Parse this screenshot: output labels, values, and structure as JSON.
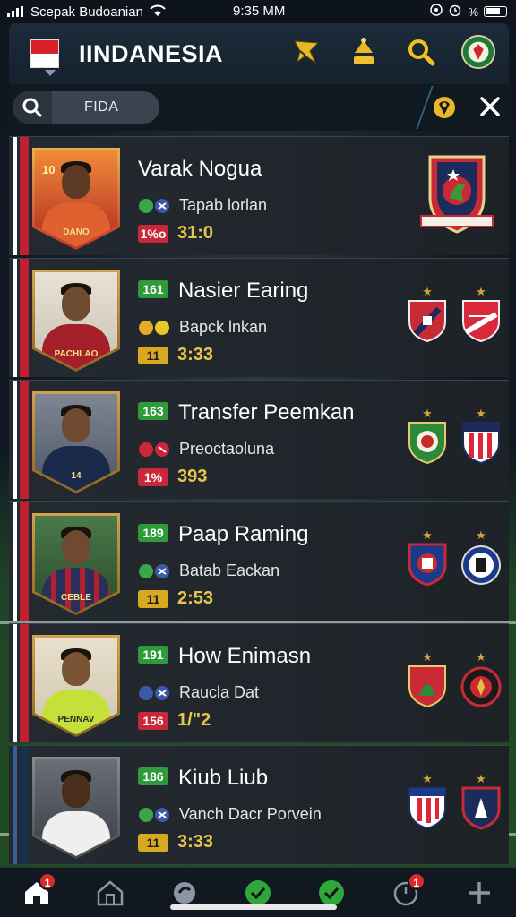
{
  "status_bar": {
    "carrier": "Scepak Budoanian",
    "time": "9:35 MM"
  },
  "header": {
    "title": "IINDANESIA",
    "flag_colors": [
      "#d8202a",
      "#ffffff"
    ]
  },
  "search": {
    "value": "FIDA"
  },
  "players": [
    {
      "name": "Varak Nogua",
      "ovr": "",
      "sub_text": "Tapab lorlan",
      "stat_tag": "1%o",
      "stat_tag_color": "#c8283a",
      "stat_value": "31:0",
      "rating_badge": "10",
      "shirt_text": "DANO",
      "shirt_color": "#d85a2a",
      "stripe": "red",
      "clubs": 1
    },
    {
      "name": "Nasier Earing",
      "ovr": "161",
      "sub_text": "Bapck lnkan",
      "stat_tag": "11",
      "stat_tag_color": "#d8a820",
      "stat_value": "3:33",
      "rating_badge": "",
      "shirt_text": "PACHLAO",
      "shirt_color": "#a51f28",
      "stripe": "red",
      "clubs": 2
    },
    {
      "name": "Transfer Peemkan",
      "ovr": "163",
      "sub_text": "Preoctaoluna",
      "stat_tag": "1%",
      "stat_tag_color": "#c8283a",
      "stat_value": "393",
      "rating_badge": "",
      "shirt_text": "14",
      "shirt_color": "#1a2a4a",
      "stripe": "red",
      "clubs": 2
    },
    {
      "name": "Paap Raming",
      "ovr": "189",
      "sub_text": "Batab Eackan",
      "stat_tag": "11",
      "stat_tag_color": "#d8a820",
      "stat_value": "2:53",
      "rating_badge": "",
      "shirt_text": "CEBLE",
      "shirt_color": "#2a2f5a",
      "stripe": "red",
      "clubs": 2
    },
    {
      "name": "How Enimasn",
      "ovr": "191",
      "sub_text": "Raucla Dat",
      "stat_tag": "156",
      "stat_tag_color": "#c8283a",
      "stat_value": "1/\"2",
      "rating_badge": "",
      "shirt_text": "PENNAV",
      "shirt_color": "#c6e03a",
      "stripe": "red",
      "clubs": 2
    },
    {
      "name": "Kiub Liub",
      "ovr": "186",
      "sub_text": "Vanch Dacr Porvein",
      "stat_tag": "11",
      "stat_tag_color": "#d8a820",
      "stat_value": "3:33",
      "rating_badge": "",
      "shirt_text": "",
      "shirt_color": "#efefef",
      "stripe": "blue",
      "clubs": 2
    }
  ],
  "bottom_nav": {
    "home_badge": "1",
    "timer_badge": "1"
  }
}
